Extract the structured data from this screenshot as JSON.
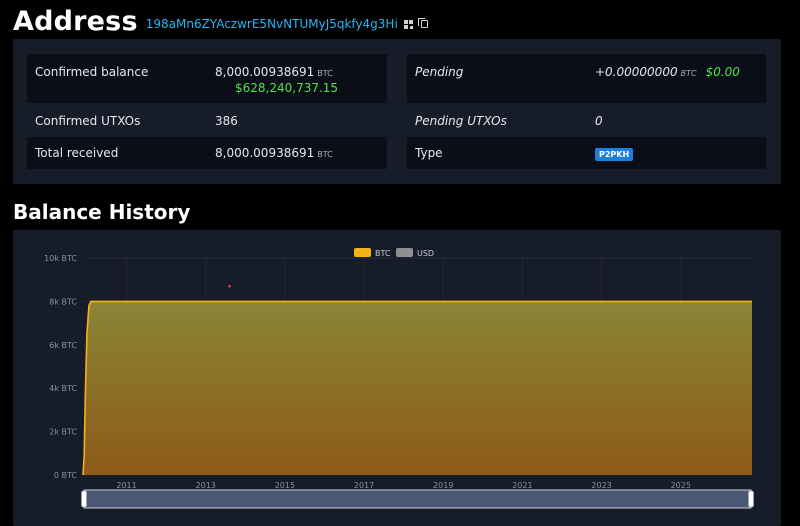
{
  "header": {
    "title": "Address",
    "address": "198aMn6ZYAczwrE5NvNTUMyJ5qkfy4g3Hi",
    "qr_icon": "qr-code-icon",
    "copy_icon": "copy-icon"
  },
  "summary": {
    "confirmed_balance": {
      "label": "Confirmed balance",
      "value": "8,000.00938691",
      "unit": "BTC",
      "usd": "$628,240,737.15"
    },
    "pending": {
      "label": "Pending",
      "value": "+0.00000000",
      "unit": "BTC",
      "usd": "$0.00"
    },
    "confirmed_utxos": {
      "label": "Confirmed UTXOs",
      "value": "386"
    },
    "pending_utxos": {
      "label": "Pending UTXOs",
      "value": "0"
    },
    "total_received": {
      "label": "Total received",
      "value": "8,000.00938691",
      "unit": "BTC"
    },
    "type": {
      "label": "Type",
      "value": "P2PKH"
    }
  },
  "history": {
    "title": "Balance History"
  },
  "colors": {
    "accent_link": "#27b5f2",
    "usd_green": "#52e24a",
    "badge_blue": "#1b7fe0",
    "btc_series": "#f7b21a",
    "usd_series": "#8f8f8f"
  },
  "chart_data": {
    "type": "area",
    "legend": [
      "BTC",
      "USD"
    ],
    "legend_placement": "top-center",
    "x_ticks": [
      "2011",
      "2013",
      "2015",
      "2017",
      "2019",
      "2021",
      "2023",
      "2025"
    ],
    "y_ticks": [
      "0 BTC",
      "2k BTC",
      "4k BTC",
      "6k BTC",
      "8k BTC",
      "10k BTC"
    ],
    "xlim": [
      2009.9,
      2026.8
    ],
    "ylim": [
      0,
      10000
    ],
    "series": [
      {
        "name": "BTC",
        "x": [
          2009.9,
          2009.93,
          2009.96,
          2010.0,
          2010.05,
          2010.1,
          2012.0,
          2014.0,
          2016.0,
          2018.0,
          2020.0,
          2022.0,
          2024.0,
          2026.8
        ],
        "y": [
          0,
          900,
          3800,
          6500,
          7800,
          8000,
          8000,
          8000,
          8000,
          8000,
          8000,
          8000,
          8000,
          8000
        ]
      }
    ],
    "annotations": [
      {
        "x": 2013.6,
        "y": 8700
      }
    ],
    "grid": true
  }
}
